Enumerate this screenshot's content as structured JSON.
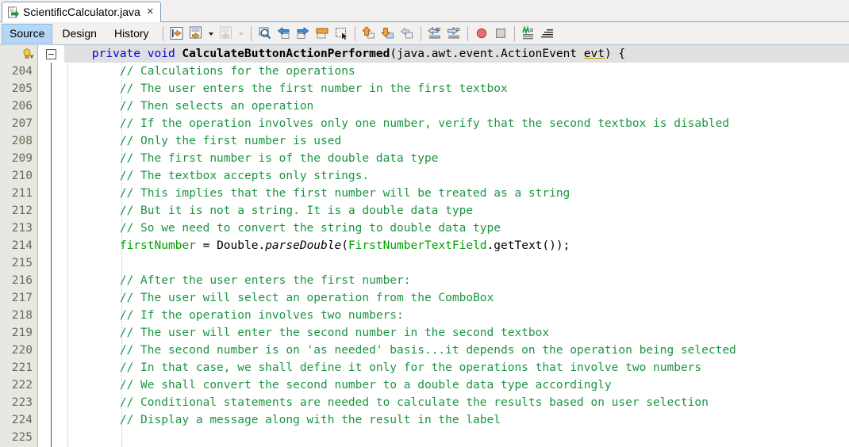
{
  "window": {
    "tab": {
      "icon": "java-file-icon",
      "label": "ScientificCalculator.java",
      "close": "×"
    }
  },
  "toolbar": {
    "views": [
      {
        "label": "Source",
        "active": true
      },
      {
        "label": "Design",
        "active": false
      },
      {
        "label": "History",
        "active": false
      }
    ],
    "icons": [
      {
        "name": "last-edit-icon"
      },
      {
        "name": "back-to-source-icon"
      },
      {
        "name": "back-dropdown-icon"
      },
      {
        "name": "forward-to-source-icon"
      },
      {
        "name": "forward-dropdown-icon"
      },
      {
        "name": "find-selection-icon"
      },
      {
        "name": "previous-bookmark-icon"
      },
      {
        "name": "next-bookmark-icon"
      },
      {
        "name": "toggle-bookmark-icon"
      },
      {
        "name": "toggle-rectangular-selection-icon"
      },
      {
        "name": "previous-error-icon"
      },
      {
        "name": "next-error-icon"
      },
      {
        "name": "previous-annotation-icon"
      },
      {
        "name": "shift-left-icon"
      },
      {
        "name": "shift-right-icon"
      },
      {
        "name": "start-macro-recording-icon"
      },
      {
        "name": "stop-macro-recording-icon"
      },
      {
        "name": "toggle-highlight-search-icon"
      },
      {
        "name": "toggle-line-wrap-icon"
      }
    ]
  },
  "editor": {
    "gutter_warning_icon": "warning-lightbulb-icon",
    "fold_marker": "collapse-fold-icon",
    "header_line": {
      "number": "",
      "tokens": [
        {
          "t": "    ",
          "cls": "p"
        },
        {
          "t": "private",
          "cls": "k"
        },
        {
          "t": " ",
          "cls": "p"
        },
        {
          "t": "void",
          "cls": "k"
        },
        {
          "t": " ",
          "cls": "p"
        },
        {
          "t": "CalculateButtonActionPerformed",
          "cls": "m"
        },
        {
          "t": "(java.awt.event.ActionEvent ",
          "cls": "p"
        },
        {
          "t": "evt",
          "cls": "und"
        },
        {
          "t": ") {",
          "cls": "p"
        }
      ]
    },
    "lines": [
      {
        "number": "204",
        "tokens": [
          {
            "t": "        ",
            "cls": "p"
          },
          {
            "t": "// Calculations for the operations",
            "cls": "c"
          }
        ]
      },
      {
        "number": "205",
        "tokens": [
          {
            "t": "        ",
            "cls": "p"
          },
          {
            "t": "// The user enters the first number in the first textbox",
            "cls": "c"
          }
        ]
      },
      {
        "number": "206",
        "tokens": [
          {
            "t": "        ",
            "cls": "p"
          },
          {
            "t": "// Then selects an operation",
            "cls": "c"
          }
        ]
      },
      {
        "number": "207",
        "tokens": [
          {
            "t": "        ",
            "cls": "p"
          },
          {
            "t": "// If the operation involves only one number, verify that the second textbox is disabled",
            "cls": "c"
          }
        ]
      },
      {
        "number": "208",
        "tokens": [
          {
            "t": "        ",
            "cls": "p"
          },
          {
            "t": "// Only the first number is used",
            "cls": "c"
          }
        ]
      },
      {
        "number": "209",
        "tokens": [
          {
            "t": "        ",
            "cls": "p"
          },
          {
            "t": "// The first number is of the double data type",
            "cls": "c"
          }
        ]
      },
      {
        "number": "210",
        "tokens": [
          {
            "t": "        ",
            "cls": "p"
          },
          {
            "t": "// The textbox accepts only strings.",
            "cls": "c"
          }
        ]
      },
      {
        "number": "211",
        "tokens": [
          {
            "t": "        ",
            "cls": "p"
          },
          {
            "t": "// This implies that the first number will be treated as a string",
            "cls": "c"
          }
        ]
      },
      {
        "number": "212",
        "tokens": [
          {
            "t": "        ",
            "cls": "p"
          },
          {
            "t": "// But it is not a string. It is a double data type",
            "cls": "c"
          }
        ]
      },
      {
        "number": "213",
        "tokens": [
          {
            "t": "        ",
            "cls": "p"
          },
          {
            "t": "// So we need to convert the string to double data type",
            "cls": "c"
          }
        ]
      },
      {
        "number": "214",
        "tokens": [
          {
            "t": "        ",
            "cls": "p"
          },
          {
            "t": "firstNumber",
            "cls": "f"
          },
          {
            "t": " = Double.",
            "cls": "p"
          },
          {
            "t": "parseDouble",
            "cls": "i"
          },
          {
            "t": "(",
            "cls": "p"
          },
          {
            "t": "FirstNumberTextField",
            "cls": "f"
          },
          {
            "t": ".getText());",
            "cls": "p"
          }
        ]
      },
      {
        "number": "215",
        "tokens": [
          {
            "t": "",
            "cls": "p"
          }
        ]
      },
      {
        "number": "216",
        "tokens": [
          {
            "t": "        ",
            "cls": "p"
          },
          {
            "t": "// After the user enters the first number:",
            "cls": "c"
          }
        ]
      },
      {
        "number": "217",
        "tokens": [
          {
            "t": "        ",
            "cls": "p"
          },
          {
            "t": "// The user will select an operation from the ComboBox",
            "cls": "c"
          }
        ]
      },
      {
        "number": "218",
        "tokens": [
          {
            "t": "        ",
            "cls": "p"
          },
          {
            "t": "// If the operation involves two numbers:",
            "cls": "c"
          }
        ]
      },
      {
        "number": "219",
        "tokens": [
          {
            "t": "        ",
            "cls": "p"
          },
          {
            "t": "// The user will enter the second number in the second textbox",
            "cls": "c"
          }
        ]
      },
      {
        "number": "220",
        "tokens": [
          {
            "t": "        ",
            "cls": "p"
          },
          {
            "t": "// The second number is on 'as needed' basis...it depends on the operation being selected",
            "cls": "c"
          }
        ]
      },
      {
        "number": "221",
        "tokens": [
          {
            "t": "        ",
            "cls": "p"
          },
          {
            "t": "// In that case, we shall define it only for the operations that involve two numbers",
            "cls": "c"
          }
        ]
      },
      {
        "number": "222",
        "tokens": [
          {
            "t": "        ",
            "cls": "p"
          },
          {
            "t": "// We shall convert the second number to a double data type accordingly",
            "cls": "c"
          }
        ]
      },
      {
        "number": "223",
        "tokens": [
          {
            "t": "        ",
            "cls": "p"
          },
          {
            "t": "// Conditional statements are needed to calculate the results based on user selection",
            "cls": "c"
          }
        ]
      },
      {
        "number": "224",
        "tokens": [
          {
            "t": "        ",
            "cls": "p"
          },
          {
            "t": "// Display a message along with the result in the label",
            "cls": "c"
          }
        ]
      },
      {
        "number": "225",
        "tokens": [
          {
            "t": "",
            "cls": "p"
          }
        ]
      }
    ]
  },
  "colors": {
    "keyword": "#0000e6",
    "comment": "#1a9641",
    "field": "#00a000",
    "tab_border": "#7a9cc6",
    "active_view": "#b5d6f5",
    "gutter_bg": "#e8e8e2",
    "current_line_bg": "#e0e0e0"
  }
}
